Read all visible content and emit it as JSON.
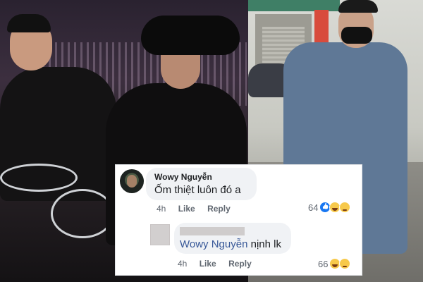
{
  "comments": [
    {
      "author": "Wowy Nguyễn",
      "text": "Ốm thiệt luôn đó a",
      "time": "4h",
      "like_label": "Like",
      "reply_label": "Reply",
      "reaction_count": "64",
      "reactions": [
        "like-icon",
        "haha-icon",
        "sad-icon"
      ]
    },
    {
      "mention": "Wowy Nguyễn",
      "text": " nịnh lk",
      "time": "4h",
      "like_label": "Like",
      "reply_label": "Reply",
      "reaction_count": "66",
      "reactions": [
        "haha-icon",
        "sad-icon"
      ]
    }
  ],
  "colors": {
    "mention": "#385898",
    "bubble": "#f0f2f5",
    "like_blue": "#1877f2"
  }
}
